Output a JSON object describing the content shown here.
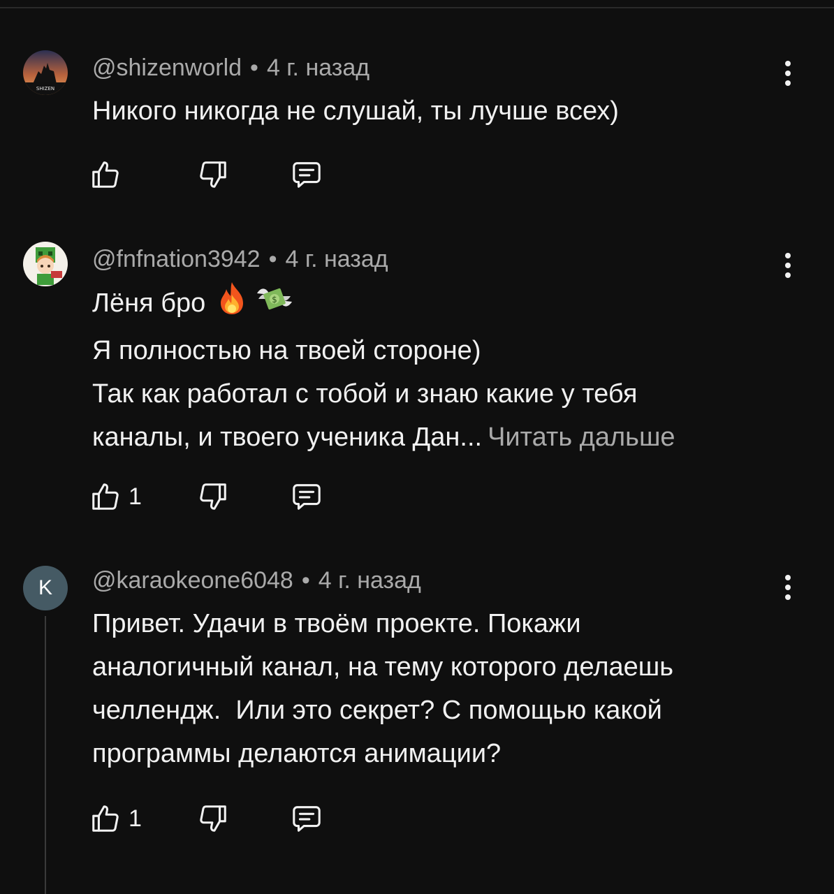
{
  "comments": [
    {
      "author": "@shizenworld",
      "time": "4 г. назад",
      "avatar_text": "SHIZEN",
      "lines": [
        "Никого никогда не слушай, ты лучше всех)"
      ],
      "likes": ""
    },
    {
      "author": "@fnfnation3942",
      "time": "4 г. назад",
      "lines": [
        "Лёня бро",
        "Я полностью на твоей стороне)",
        "Так как работал с тобой и знаю какие у тебя",
        "каналы, и твоего ученика Дан..."
      ],
      "read_more": "Читать дальше",
      "emojis": [
        "fire-emoji",
        "money-with-wings-emoji"
      ],
      "likes": "1"
    },
    {
      "author": "@karaokeone6048",
      "time": "4 г. назад",
      "avatar_letter": "K",
      "lines": [
        "Привет. Удачи в твоём проекте. Покажи",
        "аналогичный канал, на тему которого делаешь",
        "челлендж.  Или это секрет? С помощью какой",
        "программы делаются анимации?"
      ],
      "likes": "1"
    }
  ],
  "separator": "•",
  "icons": {
    "like": "thumb-up-icon",
    "dislike": "thumb-down-icon",
    "reply": "reply-comment-icon",
    "menu": "more-vert-icon"
  },
  "colors": {
    "background": "#0f0f0f",
    "primary_text": "#f1f1f1",
    "secondary_text": "#aaaaaa",
    "letter_avatar": "#455a64"
  }
}
